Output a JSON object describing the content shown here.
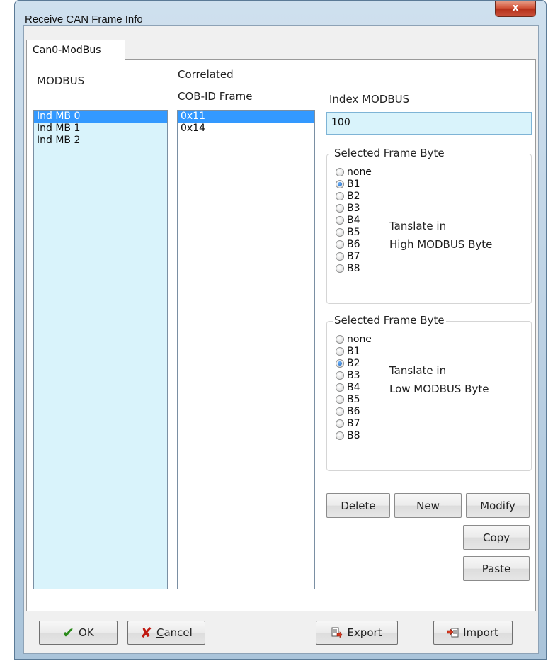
{
  "window": {
    "title": "Receive CAN Frame Info",
    "close_glyph": "x"
  },
  "tabs": [
    {
      "label": "Can0-ModBus"
    }
  ],
  "modbus": {
    "header": "MODBUS",
    "items": [
      {
        "label": "Ind MB 0",
        "selected": true
      },
      {
        "label": "Ind MB 1",
        "selected": false
      },
      {
        "label": "Ind MB 2",
        "selected": false
      }
    ]
  },
  "cobid": {
    "header_line1": "Correlated",
    "header_line2": "COB-ID Frame",
    "items": [
      {
        "label": "0x11",
        "selected": true
      },
      {
        "label": "0x14",
        "selected": false
      }
    ]
  },
  "index_modbus": {
    "label": "Index MODBUS",
    "value": "100"
  },
  "high_group": {
    "title": "Selected Frame Byte",
    "options": [
      "none",
      "B1",
      "B2",
      "B3",
      "B4",
      "B5",
      "B6",
      "B7",
      "B8"
    ],
    "selected": "B1",
    "note_line1": "Tanslate in",
    "note_line2": "High MODBUS Byte"
  },
  "low_group": {
    "title": "Selected Frame Byte",
    "options": [
      "none",
      "B1",
      "B2",
      "B3",
      "B4",
      "B5",
      "B6",
      "B7",
      "B8"
    ],
    "selected": "B2",
    "note_line1": "Tanslate in",
    "note_line2": "Low MODBUS Byte"
  },
  "actions": {
    "delete": "Delete",
    "new": "New",
    "modify": "Modify",
    "copy": "Copy",
    "paste": "Paste"
  },
  "footer": {
    "ok": "OK",
    "cancel_prefix": "C",
    "cancel_rest": "ancel",
    "export": "Export",
    "import": "Import"
  },
  "colors": {
    "list_bg": "#d9f3fb",
    "selection": "#3399ff",
    "window_frame": "#b9cfe2"
  }
}
